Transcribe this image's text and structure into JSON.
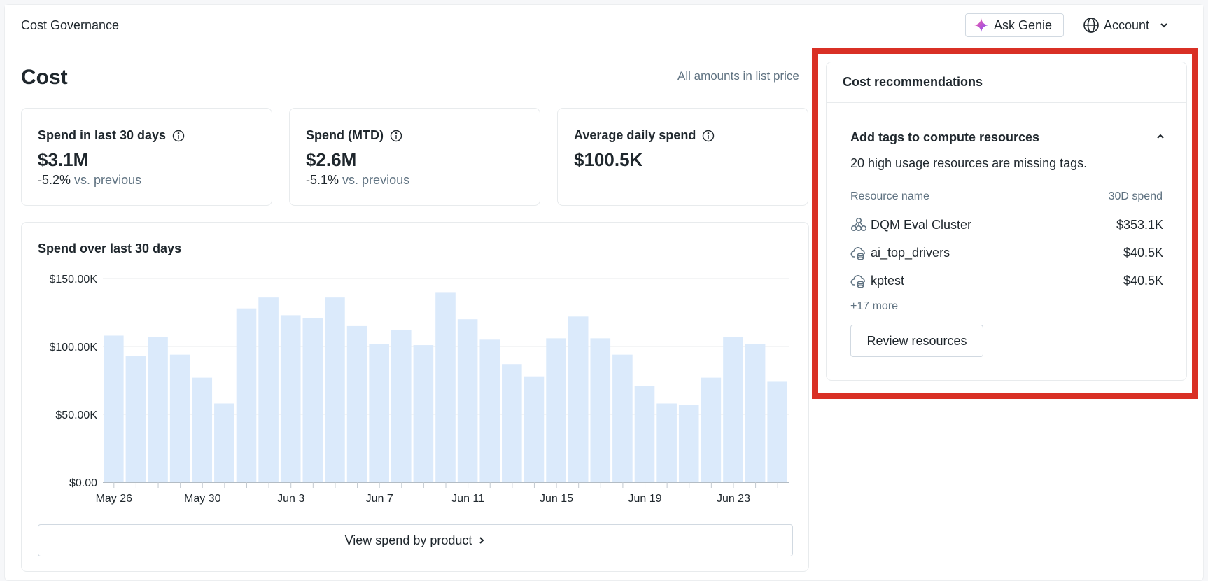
{
  "app": {
    "title": "Cost Governance"
  },
  "header": {
    "ask_genie": "Ask Genie",
    "account": "Account"
  },
  "page": {
    "title": "Cost",
    "note": "All amounts in list price"
  },
  "kpis": [
    {
      "label": "Spend in last 30 days",
      "value": "$3.1M",
      "change": "-5.2%",
      "vs": "vs. previous"
    },
    {
      "label": "Spend (MTD)",
      "value": "$2.6M",
      "change": "-5.1%",
      "vs": "vs. previous"
    },
    {
      "label": "Average daily spend",
      "value": "$100.5K",
      "change": "",
      "vs": ""
    }
  ],
  "chart_card": {
    "title": "Spend over last 30 days",
    "button": "View spend by product"
  },
  "chart_data": {
    "type": "bar",
    "title": "Spend over last 30 days",
    "xlabel": "",
    "ylabel": "",
    "categories": [
      "May 26",
      "May 27",
      "May 28",
      "May 29",
      "May 30",
      "May 31",
      "Jun 1",
      "Jun 2",
      "Jun 3",
      "Jun 4",
      "Jun 5",
      "Jun 6",
      "Jun 7",
      "Jun 8",
      "Jun 9",
      "Jun 10",
      "Jun 11",
      "Jun 12",
      "Jun 13",
      "Jun 14",
      "Jun 15",
      "Jun 16",
      "Jun 17",
      "Jun 18",
      "Jun 19",
      "Jun 20",
      "Jun 21",
      "Jun 22",
      "Jun 23",
      "Jun 24",
      "Jun 25"
    ],
    "values": [
      108000,
      93000,
      107000,
      94000,
      77000,
      58000,
      128000,
      136000,
      123000,
      121000,
      136000,
      115000,
      102000,
      112000,
      101000,
      140000,
      120000,
      105000,
      87000,
      78000,
      106000,
      122000,
      106000,
      94000,
      71000,
      58000,
      57000,
      77000,
      107000,
      102000,
      74000
    ],
    "x_tick_labels": [
      "May 26",
      "May 30",
      "Jun 3",
      "Jun 7",
      "Jun 11",
      "Jun 15",
      "Jun 19",
      "Jun 23"
    ],
    "y_tick_labels": [
      "$0.00",
      "$50.00K",
      "$100.00K",
      "$150.00K"
    ],
    "ylim": [
      0,
      150000
    ],
    "grid": true,
    "bar_color": "#dbeafb"
  },
  "recommendations": {
    "title": "Cost recommendations",
    "item_title": "Add tags to compute resources",
    "item_desc": "20 high usage resources are missing tags.",
    "col_name": "Resource name",
    "col_spend": "30D spend",
    "rows": [
      {
        "icon": "cluster-icon",
        "name": "DQM Eval Cluster",
        "spend": "$353.1K"
      },
      {
        "icon": "serverless-cloud-icon",
        "name": "ai_top_drivers",
        "spend": "$40.5K"
      },
      {
        "icon": "serverless-cloud-icon",
        "name": "kptest",
        "spend": "$40.5K"
      }
    ],
    "more": "+17 more",
    "button": "Review resources"
  },
  "colors": {
    "highlight": "#d93025",
    "bar": "#dbeafb",
    "muted": "#5f7281"
  }
}
